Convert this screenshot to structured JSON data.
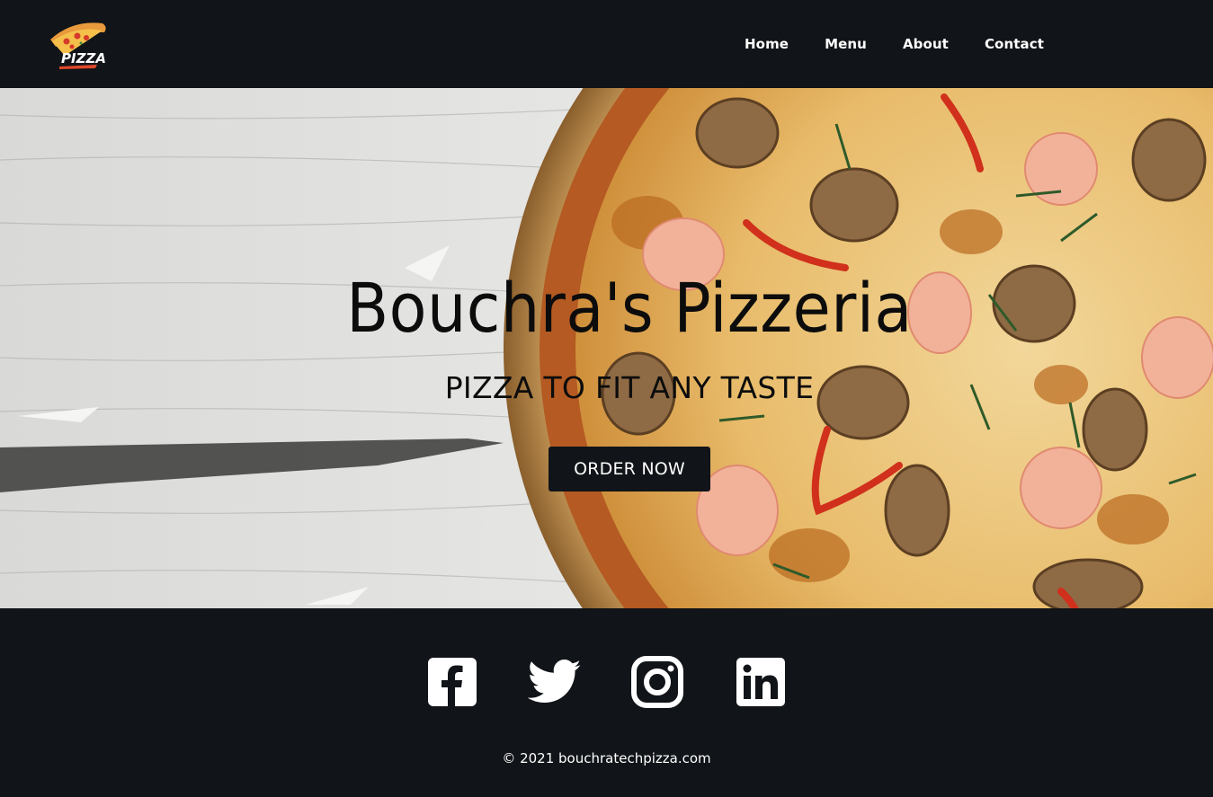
{
  "header": {
    "logo_text": "PIZZA",
    "nav": [
      {
        "label": "Home"
      },
      {
        "label": "Menu"
      },
      {
        "label": "About"
      },
      {
        "label": "Contact"
      }
    ]
  },
  "hero": {
    "title": "Bouchra's Pizzeria",
    "subtitle": "PIZZA TO FIT ANY TASTE",
    "cta_label": "ORDER NOW"
  },
  "footer": {
    "socials": [
      {
        "icon": "facebook-icon"
      },
      {
        "icon": "twitter-icon"
      },
      {
        "icon": "instagram-icon"
      },
      {
        "icon": "linkedin-icon"
      }
    ],
    "copyright": "© 2021 bouchratechpizza.com"
  },
  "colors": {
    "dark": "#111418",
    "text_light": "#ffffff",
    "text_dark": "#0c0c0c"
  }
}
